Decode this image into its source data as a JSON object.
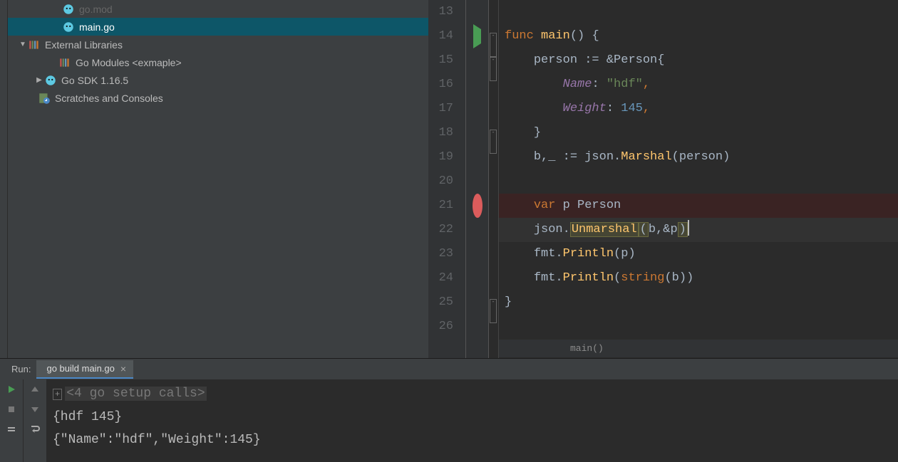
{
  "tree": {
    "items": [
      {
        "label": "go.mod",
        "indent": 62,
        "arrow": "none",
        "icon": "go",
        "selected": false,
        "dim": true
      },
      {
        "label": "main.go",
        "indent": 62,
        "arrow": "none",
        "icon": "go",
        "selected": true
      },
      {
        "label": "External Libraries",
        "indent": 14,
        "arrow": "down",
        "icon": "lib",
        "selected": false
      },
      {
        "label": "Go Modules <exmaple>",
        "indent": 57,
        "arrow": "none",
        "icon": "lib",
        "selected": false
      },
      {
        "label": "Go SDK 1.16.5",
        "indent": 37,
        "arrow": "right",
        "icon": "go",
        "selected": false
      },
      {
        "label": "Scratches and Consoles",
        "indent": 28,
        "arrow": "none",
        "icon": "sc",
        "selected": false
      }
    ]
  },
  "editor": {
    "lineStart": 13,
    "lineEnd": 26,
    "runMarker": 14,
    "breakpoint": 21,
    "currentLine": 22,
    "breadcrumb": "main()"
  },
  "code": {
    "l14": {
      "func": "func",
      "name": "main",
      "parens": "()",
      "brace": "{"
    },
    "l15": {
      "v": "person",
      "assign": ":=",
      "amp": "&",
      "type": "Person",
      "brace": "{"
    },
    "l16": {
      "field": "Name",
      "colon": ":",
      "val": "\"hdf\"",
      "comma": ","
    },
    "l17": {
      "field": "Weight",
      "colon": ":",
      "val": "145",
      "comma": ","
    },
    "l18": {
      "brace": "}"
    },
    "l19": {
      "a": "b",
      "comma1": ",",
      "blank": "_",
      "assign": ":=",
      "pkg": "json",
      "dot": ".",
      "fn": "Marshal",
      "op": "(",
      "arg": "person",
      "cp": ")"
    },
    "l21": {
      "kw": "var",
      "name": "p",
      "type": "Person"
    },
    "l22": {
      "pkg": "json",
      "dot": ".",
      "fn": "Unmarshal",
      "op": "(",
      "a1": "b",
      "comma": ",",
      "amp": "&",
      "a2": "p",
      "cp": ")"
    },
    "l23": {
      "pkg": "fmt",
      "dot": ".",
      "fn": "Println",
      "op": "(",
      "arg": "p",
      "cp": ")"
    },
    "l24": {
      "pkg": "fmt",
      "dot": ".",
      "fn": "Println",
      "op": "(",
      "cast": "string",
      "op2": "(",
      "arg": "b",
      "cp2": ")",
      "cp": ")"
    },
    "l25": {
      "brace": "}"
    }
  },
  "run": {
    "label": "Run:",
    "tab": "go build main.go",
    "setup": "<4 go setup calls>",
    "out1": "{hdf 145}",
    "out2": "{\"Name\":\"hdf\",\"Weight\":145}"
  }
}
